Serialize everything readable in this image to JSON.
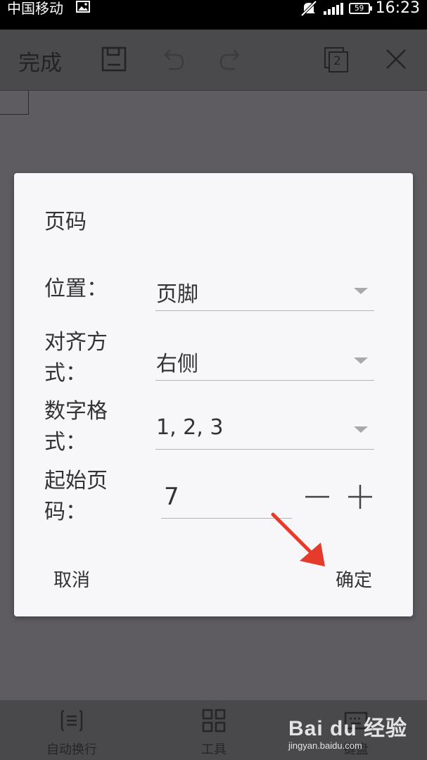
{
  "status_bar": {
    "carrier": "中国移动",
    "battery": "59",
    "time": "16:23"
  },
  "toolbar": {
    "done_label": "完成",
    "pages_badge": "2"
  },
  "dialog": {
    "title": "页码",
    "rows": [
      {
        "label": "位置：",
        "value": "页脚"
      },
      {
        "label": "对齐方式：",
        "value": "右侧"
      },
      {
        "label": "数字格式：",
        "value": "1, 2, 3"
      }
    ],
    "start_page": {
      "label": "起始页码：",
      "value": "7"
    },
    "cancel_label": "取消",
    "confirm_label": "确定"
  },
  "bottom_bar": {
    "items": [
      {
        "label": "自动换行",
        "icon": "wrap-icon"
      },
      {
        "label": "工具",
        "icon": "grid-icon"
      },
      {
        "label": "键盘",
        "icon": "keyboard-icon"
      }
    ]
  },
  "watermark": {
    "logo": "Bai du 经验",
    "url": "jingyan.baidu.com"
  },
  "colors": {
    "overlay": "#5e5c61",
    "dialog_bg": "#f7f6f8",
    "text": "#333333",
    "arrow": "#e53b2c"
  }
}
